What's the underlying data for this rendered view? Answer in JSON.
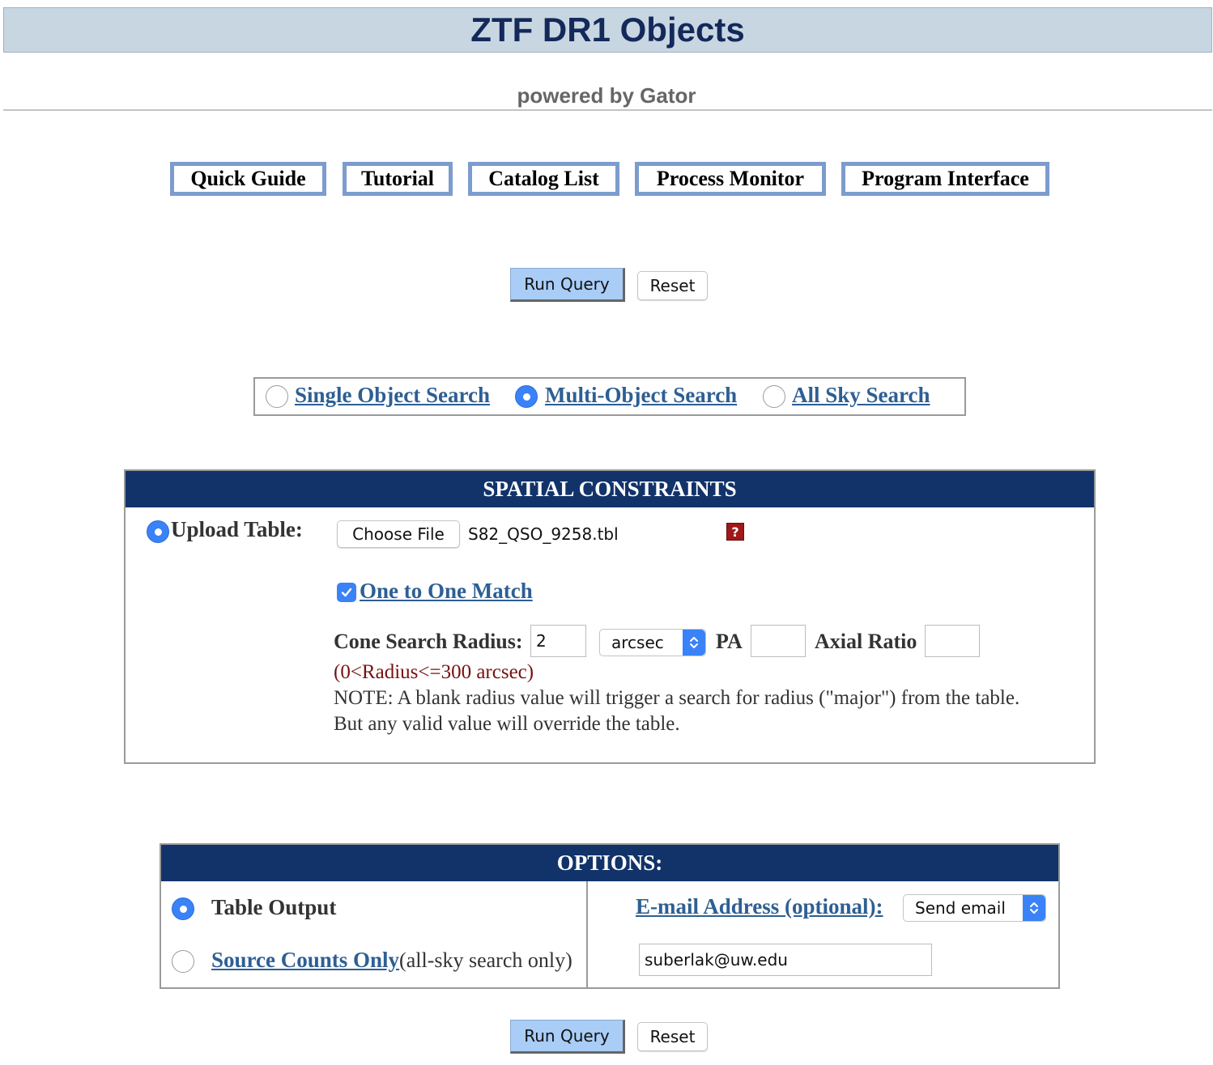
{
  "header": {
    "title": "ZTF DR1 Objects",
    "subtitle": "powered by Gator"
  },
  "nav": [
    {
      "label": "Quick Guide"
    },
    {
      "label": "Tutorial"
    },
    {
      "label": "Catalog List"
    },
    {
      "label": "Process Monitor"
    },
    {
      "label": "Program Interface"
    }
  ],
  "actions": {
    "run_label": "Run Query",
    "reset_label": "Reset"
  },
  "search_type": {
    "options": [
      {
        "label": "Single Object Search",
        "selected": false
      },
      {
        "label": "Multi-Object Search",
        "selected": true
      },
      {
        "label": "All Sky Search",
        "selected": false
      }
    ]
  },
  "spatial": {
    "heading": "SPATIAL CONSTRAINTS",
    "upload_label": "Upload Table:",
    "upload_selected": true,
    "choose_file_label": "Choose File",
    "file_name": "S82_QSO_9258.tbl",
    "help_icon": "question-icon",
    "one_to_one_label": "One to One Match",
    "one_to_one_checked": true,
    "radius_label": "Cone Search Radius:",
    "radius_value": "2",
    "radius_unit": "arcsec",
    "pa_label": "PA",
    "pa_value": "",
    "axial_ratio_label": "Axial Ratio",
    "axial_ratio_value": "",
    "radius_hint": "(0<Radius<=300 arcsec)",
    "note_line1": "NOTE: A blank radius value will trigger a search for radius (\"major\") from the table.",
    "note_line2": "But any valid value will override the table."
  },
  "options": {
    "heading": "OPTIONS:",
    "table_output_label": "Table Output",
    "table_output_selected": true,
    "source_counts_label": "Source Counts Only",
    "source_counts_suffix": "(all-sky search only)",
    "source_counts_selected": false,
    "email_label": "E-mail Address (optional):",
    "email_select_value": "Send email",
    "email_value": "suberlak@uw.edu"
  },
  "colors": {
    "header_bg": "#c8d6e2",
    "title_color": "#14295a",
    "panel_head": "#12336a",
    "nav_border": "#7c9ccd",
    "link": "#2d5f94",
    "accent": "#3a82f7",
    "run_button": "#a9cdf6",
    "hint_color": "#7a1010"
  }
}
